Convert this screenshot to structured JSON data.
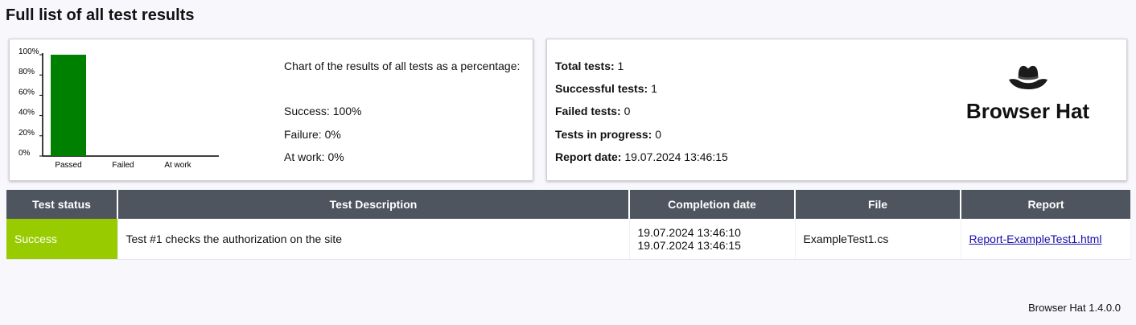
{
  "page": {
    "title": "Full list of all test results"
  },
  "chart_data": {
    "type": "bar",
    "categories": [
      "Passed",
      "Failed",
      "At work"
    ],
    "values": [
      100,
      0,
      0
    ],
    "ylim": [
      0,
      100
    ],
    "yticks": [
      "0%",
      "20%",
      "40%",
      "60%",
      "80%",
      "100%"
    ],
    "colors": [
      "#008000",
      "#008000",
      "#008000"
    ],
    "title": "",
    "xlabel": "",
    "ylabel": ""
  },
  "summary": {
    "heading": "Chart of the results of all tests as a percentage:",
    "success": "Success: 100%",
    "failure": "Failure: 0%",
    "at_work": "At work: 0%"
  },
  "stats": {
    "total_label": "Total tests:",
    "total_value": "1",
    "success_label": "Successful tests:",
    "success_value": "1",
    "failed_label": "Failed tests:",
    "failed_value": "0",
    "progress_label": "Tests in progress:",
    "progress_value": "0",
    "date_label": "Report date:",
    "date_value": "19.07.2024 13:46:15"
  },
  "brand": {
    "name": "Browser Hat",
    "logo_icon": "hat-icon"
  },
  "table": {
    "columns": [
      "Test status",
      "Test Description",
      "Completion date",
      "File",
      "Report"
    ],
    "rows": [
      {
        "status": "Success",
        "status_color": "#99cc00",
        "description": "Test #1 checks the authorization on the site",
        "date_start": "19.07.2024 13:46:10",
        "date_end": "19.07.2024 13:46:15",
        "file": "ExampleTest1.cs",
        "report": "Report-ExampleTest1.html"
      }
    ]
  },
  "footer": {
    "version": "Browser Hat 1.4.0.0"
  }
}
